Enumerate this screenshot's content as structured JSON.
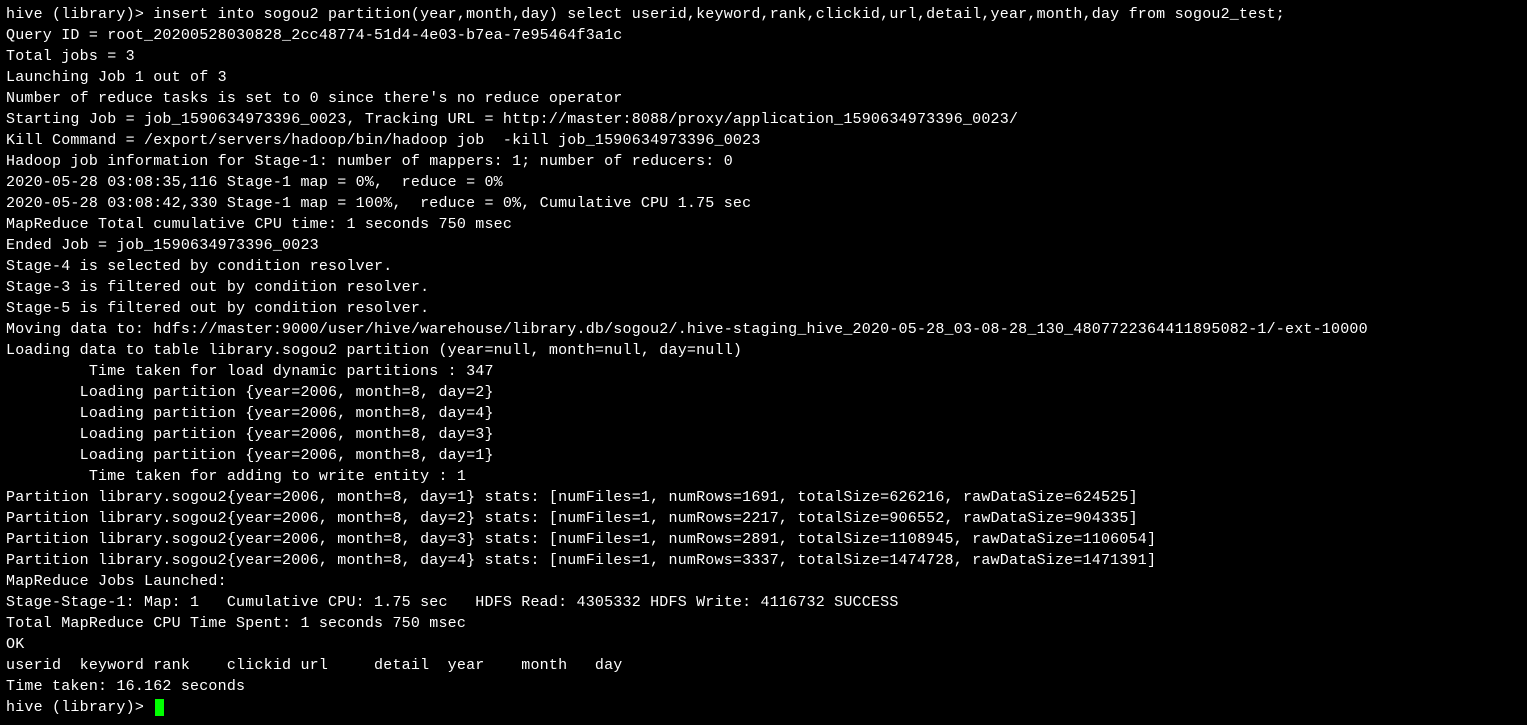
{
  "lines": {
    "l00": "hive (library)> insert into sogou2 partition(year,month,day) select userid,keyword,rank,clickid,url,detail,year,month,day from sogou2_test;",
    "l01": "Query ID = root_20200528030828_2cc48774-51d4-4e03-b7ea-7e95464f3a1c",
    "l02": "Total jobs = 3",
    "l03": "Launching Job 1 out of 3",
    "l04": "Number of reduce tasks is set to 0 since there's no reduce operator",
    "l05": "Starting Job = job_1590634973396_0023, Tracking URL = http://master:8088/proxy/application_1590634973396_0023/",
    "l06": "Kill Command = /export/servers/hadoop/bin/hadoop job  -kill job_1590634973396_0023",
    "l07": "Hadoop job information for Stage-1: number of mappers: 1; number of reducers: 0",
    "l08": "2020-05-28 03:08:35,116 Stage-1 map = 0%,  reduce = 0%",
    "l09": "2020-05-28 03:08:42,330 Stage-1 map = 100%,  reduce = 0%, Cumulative CPU 1.75 sec",
    "l10": "MapReduce Total cumulative CPU time: 1 seconds 750 msec",
    "l11": "Ended Job = job_1590634973396_0023",
    "l12": "Stage-4 is selected by condition resolver.",
    "l13": "Stage-3 is filtered out by condition resolver.",
    "l14": "Stage-5 is filtered out by condition resolver.",
    "l15": "Moving data to: hdfs://master:9000/user/hive/warehouse/library.db/sogou2/.hive-staging_hive_2020-05-28_03-08-28_130_4807722364411895082-1/-ext-10000",
    "l16": "Loading data to table library.sogou2 partition (year=null, month=null, day=null)",
    "l17": "         Time taken for load dynamic partitions : 347",
    "l18": "        Loading partition {year=2006, month=8, day=2}",
    "l19": "        Loading partition {year=2006, month=8, day=4}",
    "l20": "        Loading partition {year=2006, month=8, day=3}",
    "l21": "        Loading partition {year=2006, month=8, day=1}",
    "l22": "         Time taken for adding to write entity : 1",
    "l23": "Partition library.sogou2{year=2006, month=8, day=1} stats: [numFiles=1, numRows=1691, totalSize=626216, rawDataSize=624525]",
    "l24": "Partition library.sogou2{year=2006, month=8, day=2} stats: [numFiles=1, numRows=2217, totalSize=906552, rawDataSize=904335]",
    "l25": "Partition library.sogou2{year=2006, month=8, day=3} stats: [numFiles=1, numRows=2891, totalSize=1108945, rawDataSize=1106054]",
    "l26": "Partition library.sogou2{year=2006, month=8, day=4} stats: [numFiles=1, numRows=3337, totalSize=1474728, rawDataSize=1471391]",
    "l27": "MapReduce Jobs Launched:",
    "l28": "Stage-Stage-1: Map: 1   Cumulative CPU: 1.75 sec   HDFS Read: 4305332 HDFS Write: 4116732 SUCCESS",
    "l29": "Total MapReduce CPU Time Spent: 1 seconds 750 msec",
    "l30": "OK",
    "l31": "userid  keyword rank    clickid url     detail  year    month   day",
    "l32": "Time taken: 16.162 seconds",
    "l33": "hive (library)> "
  }
}
